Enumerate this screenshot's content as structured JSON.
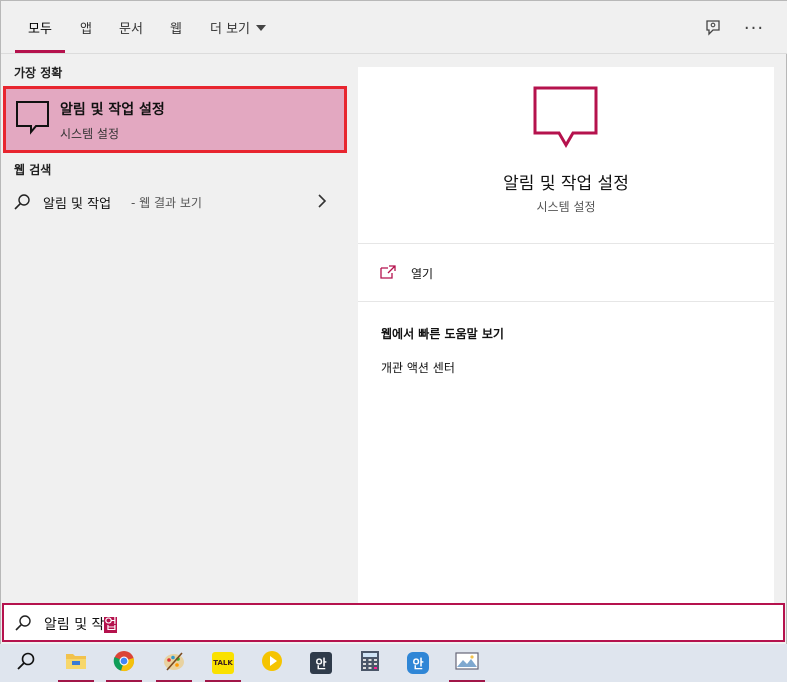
{
  "tabs": [
    {
      "label": "모두",
      "active": true
    },
    {
      "label": "앱"
    },
    {
      "label": "문서"
    },
    {
      "label": "웹"
    },
    {
      "label": "더 보기"
    }
  ],
  "top_icons": [
    "feedback-icon",
    "more-options-icon"
  ],
  "more_glyph": "···",
  "left": {
    "best_match_label": "가장 정확",
    "best_match": {
      "title": "알림 및 작업 설정",
      "subtitle": "시스템 설정",
      "icon": "notification-icon"
    },
    "web_search_label": "웹 검색",
    "web_result": {
      "query": "알림 및 작업",
      "suffix": "- 웹 결과 보기",
      "icon": "search-icon"
    }
  },
  "preview": {
    "title": "알림 및 작업 설정",
    "subtitle": "시스템 설정",
    "open_label": "열기",
    "web_help_heading": "웹에서 빠른 도움말 보기",
    "web_help_link": "개관 액션 센터"
  },
  "search": {
    "text": "알림 및 작",
    "composing": "업"
  },
  "taskbar": {
    "items": [
      {
        "name": "search",
        "running": false
      },
      {
        "name": "file-explorer",
        "running": true
      },
      {
        "name": "chrome",
        "running": true
      },
      {
        "name": "paint",
        "running": true
      },
      {
        "name": "kakaotalk",
        "running": true,
        "label": "TALK"
      },
      {
        "name": "media-player",
        "running": false
      },
      {
        "name": "hangul-editor",
        "running": false,
        "label": "안"
      },
      {
        "name": "calculator",
        "running": false
      },
      {
        "name": "hangul-viewer",
        "running": false,
        "label": "안"
      },
      {
        "name": "image-viewer",
        "running": true
      }
    ]
  },
  "colors": {
    "accent": "#b5124d",
    "selection": "#e3a8c1",
    "highlight_border": "#e8252f",
    "taskbar": "#dfe5ee"
  }
}
